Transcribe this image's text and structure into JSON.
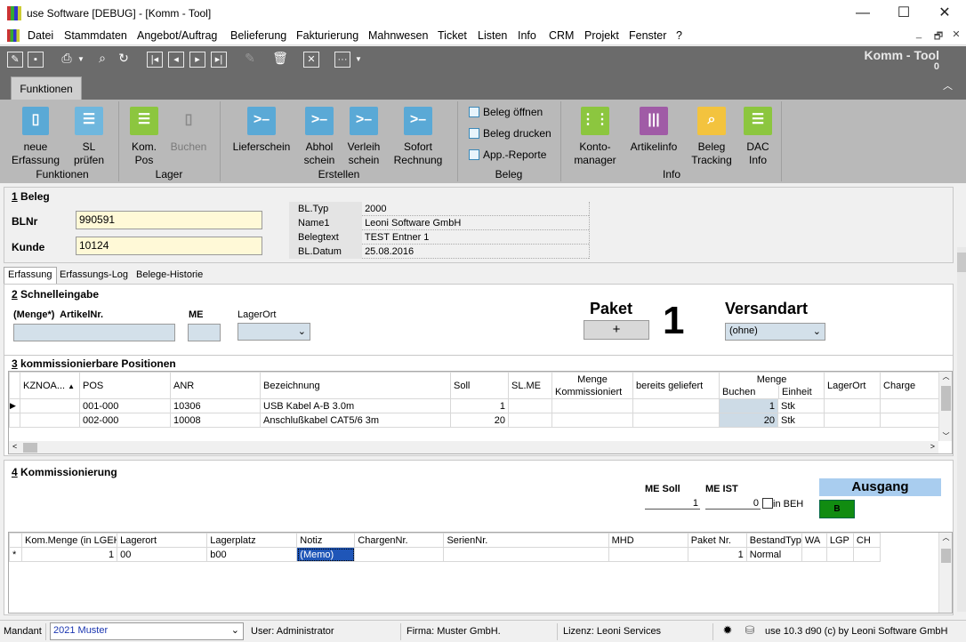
{
  "window": {
    "title": "use Software [DEBUG] - [Komm - Tool]",
    "minimize": "—",
    "maximize": "☐",
    "close": "✕"
  },
  "menu": [
    "Datei",
    "Stammdaten",
    "Angebot/Auftrag",
    "Belieferung",
    "Fakturierung",
    "Mahnwesen",
    "Ticket",
    "Listen",
    "Info",
    "CRM",
    "Projekt",
    "Fenster",
    "?"
  ],
  "mdi": {
    "min": "_",
    "restore": "🗗",
    "close": "✕"
  },
  "apptitle": {
    "name": "Komm - Tool",
    "count": "0"
  },
  "ribbon_tab": "Funktionen",
  "ribbon": {
    "groups": {
      "funktionen": "Funktionen",
      "lager": "Lager",
      "erstellen": "Erstellen",
      "beleg": "Beleg",
      "info": "Info"
    },
    "buttons": {
      "neue": "neue\nErfassung",
      "sl": "SL\nprüfen",
      "kom": "Kom.\nPos",
      "buchen": "Buchen",
      "liefer": "Lieferschein",
      "abhol": "Abhol\nschein",
      "verleih": "Verleih\nschein",
      "sofort": "Sofort\nRechnung",
      "konto": "Konto-\nmanager",
      "artikel": "Artikelinfo",
      "tracking": "Beleg\nTracking",
      "dac": "DAC\nInfo"
    },
    "checks": {
      "oeffnen": "Beleg öffnen",
      "drucken": "Beleg drucken",
      "reporte": "App.-Reporte"
    }
  },
  "beleg": {
    "heading_num": "1",
    "heading": " Beleg",
    "blnr_label": "BLNr",
    "blnr": "990591",
    "kunde_label": "Kunde",
    "kunde": "10124",
    "info": [
      {
        "k": "BL.Typ",
        "v": "2000"
      },
      {
        "k": "Name1",
        "v": "Leoni Software GmbH"
      },
      {
        "k": "Belegtext",
        "v": "TEST Entner 1"
      },
      {
        "k": "BL.Datum",
        "v": "25.08.2016"
      }
    ]
  },
  "tabs": [
    "Erfassung",
    "Erfassungs-Log",
    "Belege-Historie"
  ],
  "schnell": {
    "heading_num": "2",
    "heading": " Schnelleingabe",
    "menge_label": "(Menge*)  ArtikelNr.",
    "me_label": "ME",
    "lagerort_label": "LagerOrt",
    "paket_label": "Paket",
    "paket_btn": "+",
    "paket_value": "1",
    "versandart_label": "Versandart",
    "versandart_value": "(ohne)"
  },
  "positionen": {
    "heading_num": "3",
    "heading": " kommissionierbare Positionen",
    "headers": {
      "kzn": "KZNOA...",
      "pos": "POS",
      "anr": "ANR",
      "bez": "Bezeichnung",
      "soll": "Soll",
      "slme": "SL.ME",
      "menge_k1": "Menge",
      "menge_k2": "Kommissioniert",
      "bereits": "bereits geliefert",
      "menge_b": "Menge",
      "buchen": "Buchen",
      "einheit": "Einheit",
      "lagerort": "LagerOrt",
      "charge": "Charge"
    },
    "rows": [
      {
        "pos": "001-000",
        "anr": "10306",
        "bez": "USB Kabel A-B 3.0m",
        "soll": "1",
        "buchen": "1",
        "einheit": "Stk"
      },
      {
        "pos": "002-000",
        "anr": "10008",
        "bez": "Anschlußkabel CAT5/6 3m",
        "soll": "20",
        "buchen": "20",
        "einheit": "Stk"
      }
    ]
  },
  "kommi": {
    "heading_num": "4",
    "heading": " Kommissionierung",
    "mesoll_label": "ME Soll",
    "mesoll": "1",
    "meist_label": "ME IST",
    "meist": "0",
    "inbeh": "in BEH",
    "ausgang": "Ausgang",
    "ausgang_code": "B",
    "headers": [
      "Kom.Menge (in LGEH)",
      "Lagerort",
      "Lagerplatz",
      "Notiz",
      "ChargenNr.",
      "SerienNr.",
      "MHD",
      "Paket Nr.",
      "BestandTyp",
      "WA",
      "LGP",
      "CH"
    ],
    "row": {
      "marker": "*",
      "menge": "1",
      "lagerort": "00",
      "lagerplatz": "b00",
      "notiz": "(Memo)",
      "paket": "1",
      "bestand": "Normal"
    }
  },
  "status": {
    "mandant_label": "Mandant",
    "mandant": "2021 Muster",
    "user": "User: Administrator",
    "firma": "Firma: Muster GmbH.",
    "lizenz": "Lizenz: Leoni Services",
    "version": "use 10.3 d90 (c) by Leoni Software GmbH"
  }
}
